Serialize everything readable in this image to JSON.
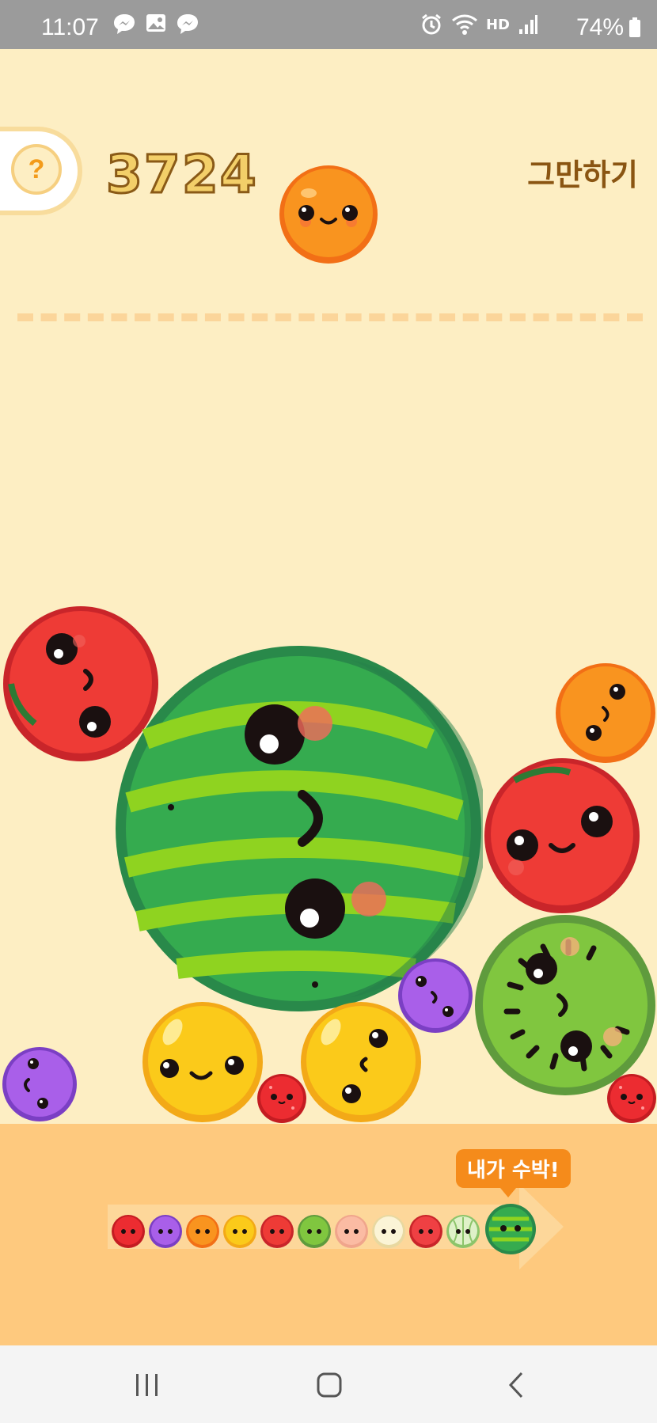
{
  "status_bar": {
    "time": "11:07",
    "battery": "74%",
    "hd_label": "HD"
  },
  "game": {
    "help_label": "?",
    "score": "3724",
    "quit_label": "그만하기",
    "next_fruit": "orange"
  },
  "evolution": {
    "bubble_label": "내가 수박!",
    "fruits": [
      "cherry",
      "grape",
      "orange",
      "dekopon",
      "apple",
      "kiwi",
      "peach",
      "pear",
      "tomato",
      "melon",
      "watermelon"
    ]
  },
  "fruit_colors": {
    "cherry": "#e8282e",
    "grape": "#a75ee8",
    "orange": "#f7901e",
    "dekopon": "#f9c516",
    "apple": "#ec3a33",
    "kiwi": "#7bc23b",
    "watermelon": "#2e9c4a",
    "background": "#fdeec3",
    "tray": "#fec97e"
  },
  "navigation": {
    "recent": "recent-apps",
    "home": "home",
    "back": "back"
  }
}
